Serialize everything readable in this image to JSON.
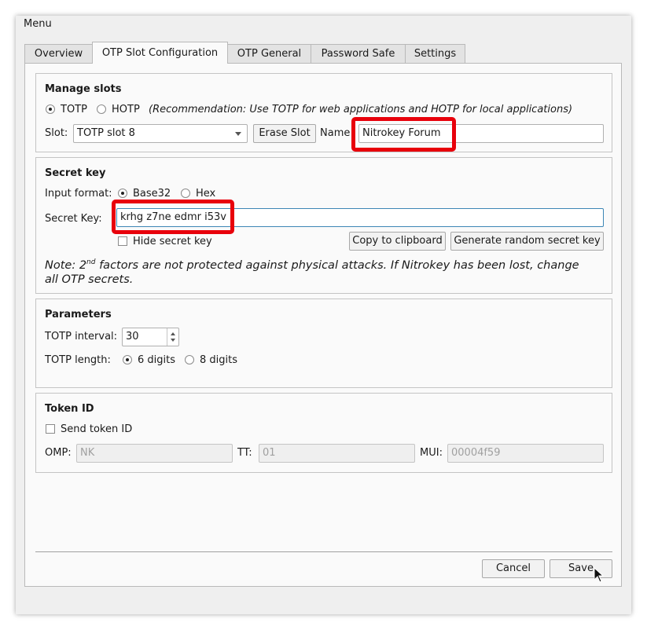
{
  "menu": {
    "label": "Menu"
  },
  "tabs": [
    {
      "label": "Overview"
    },
    {
      "label": "OTP Slot Configuration"
    },
    {
      "label": "OTP General"
    },
    {
      "label": "Password Safe"
    },
    {
      "label": "Settings"
    }
  ],
  "active_tab": "OTP Slot Configuration",
  "manage_slots": {
    "title": "Manage slots",
    "totp_label": "TOTP",
    "hotp_label": "HOTP",
    "recommendation": "(Recommendation: Use TOTP for web applications and HOTP for local applications)",
    "slot_label": "Slot:",
    "slot_value": "TOTP slot 8",
    "erase_label": "Erase Slot",
    "name_label": "Name",
    "name_value": "Nitrokey Forum",
    "selected_mode": "TOTP"
  },
  "secret_key": {
    "title": "Secret key",
    "input_format_label": "Input format:",
    "base32_label": "Base32",
    "hex_label": "Hex",
    "secret_label": "Secret Key:",
    "secret_value": "krhg z7ne edmr i53v",
    "hide_label": "Hide secret key",
    "copy_label": "Copy to clipboard",
    "generate_label": "Generate random secret key",
    "note_prefix": "Note: 2",
    "note_sup": "nd",
    "note_rest": " factors are not protected against physical attacks. If Nitrokey has been lost, change",
    "note_line2": "all OTP secrets."
  },
  "parameters": {
    "title": "Parameters",
    "interval_label": "TOTP interval:",
    "interval_value": "30",
    "length_label": "TOTP length:",
    "six_label": "6 digits",
    "eight_label": "8 digits"
  },
  "token_id": {
    "title": "Token ID",
    "send_label": "Send token ID",
    "omp_label": "OMP:",
    "omp_value": "NK",
    "tt_label": "TT:",
    "tt_value": "01",
    "mui_label": "MUI:",
    "mui_value": "00004f59"
  },
  "footer": {
    "cancel_label": "Cancel",
    "save_label": "Save"
  },
  "highlight_color": "#e8000b"
}
